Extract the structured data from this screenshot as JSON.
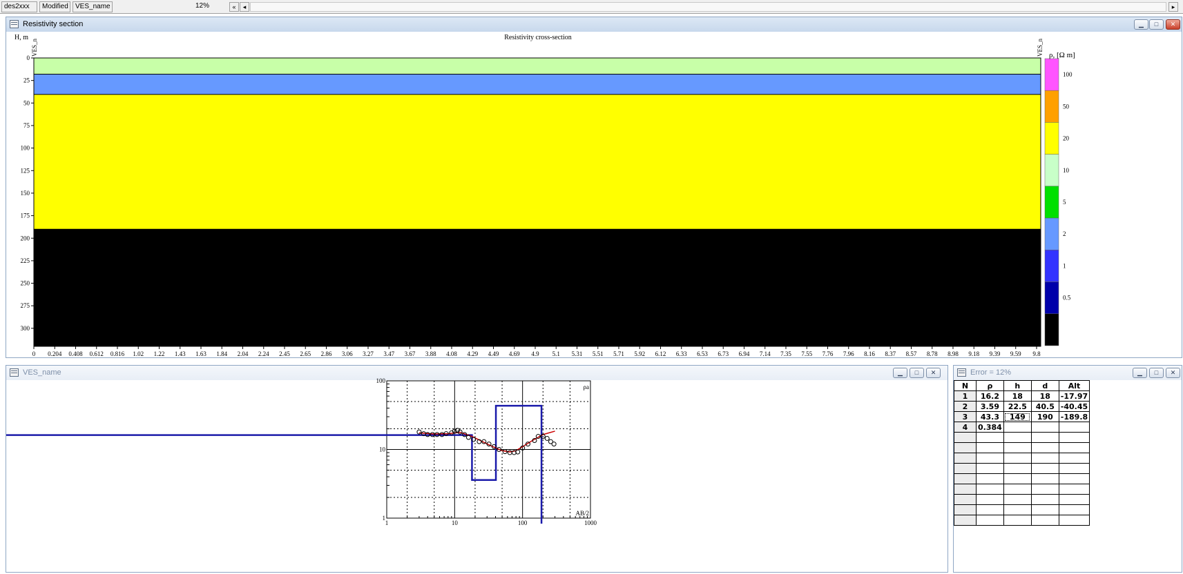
{
  "statusbar": {
    "file": "des2xxx",
    "state": "Modified",
    "ves": "VES_name",
    "error": "12%",
    "nav_first": "«",
    "nav_prev": "◂",
    "nav_next": "▸"
  },
  "section_window": {
    "title": "Resistivity section",
    "chart_title": "Resistivity cross-section",
    "y_axis_label": "H, m",
    "left_ves_label": "VES_n",
    "right_ves_label": "VES_n",
    "legend_title": "ρ, [Ω m]"
  },
  "ves_window": {
    "title": "VES_name"
  },
  "table_window": {
    "title": "Error = 12%",
    "headers": [
      "N",
      "ρ",
      "h",
      "d",
      "Alt"
    ],
    "rows": [
      [
        "1",
        "16.2",
        "18",
        "18",
        "-17.97"
      ],
      [
        "2",
        "3.59",
        "22.5",
        "40.5",
        "-40.45"
      ],
      [
        "3",
        "43.3",
        "149",
        "190",
        "-189.8"
      ],
      [
        "4",
        "0.384",
        "",
        "",
        ""
      ]
    ],
    "empty_rows": 9
  },
  "chart_data": [
    {
      "type": "heatmap",
      "title": "Resistivity cross-section",
      "ylabel": "H, m",
      "ylim": [
        0,
        320
      ],
      "y_inverted": true,
      "y_ticks": [
        0,
        25,
        50,
        75,
        100,
        125,
        150,
        175,
        200,
        225,
        250,
        275,
        300
      ],
      "x_ticks": [
        "0",
        "0.204",
        "0.408",
        "0.612",
        "0.816",
        "1.02",
        "1.22",
        "1.43",
        "1.63",
        "1.84",
        "2.04",
        "2.24",
        "2.45",
        "2.65",
        "2.86",
        "3.06",
        "3.27",
        "3.47",
        "3.67",
        "3.88",
        "4.08",
        "4.29",
        "4.49",
        "4.69",
        "4.9",
        "5.1",
        "5.31",
        "5.51",
        "5.71",
        "5.92",
        "6.12",
        "6.33",
        "6.53",
        "6.73",
        "6.94",
        "7.14",
        "7.35",
        "7.55",
        "7.76",
        "7.96",
        "8.16",
        "8.37",
        "8.57",
        "8.78",
        "8.98",
        "9.18",
        "9.39",
        "9.59",
        "9.8"
      ],
      "layers": [
        {
          "top": 0,
          "bottom": 18,
          "resistivity": 16.2,
          "color": "#c8ffa8"
        },
        {
          "top": 18,
          "bottom": 40.5,
          "resistivity": 3.59,
          "color": "#6699ff"
        },
        {
          "top": 40.5,
          "bottom": 190,
          "resistivity": 43.3,
          "color": "#ffff00"
        },
        {
          "top": 190,
          "bottom": 320,
          "resistivity": 0.384,
          "color": "#000000"
        }
      ],
      "legend": {
        "title": "ρ, [Ω m]",
        "boundaries": [
          "100",
          "50",
          "20",
          "10",
          "5",
          "2",
          "1",
          "0.5"
        ],
        "colors": [
          "#ff55ff",
          "#ffa000",
          "#ffff00",
          "#c8ffc8",
          "#00e000",
          "#6699ff",
          "#3333ff",
          "#0000aa",
          "#000000"
        ]
      }
    },
    {
      "type": "line",
      "x_scale": "log",
      "y_scale": "log",
      "xlim": [
        1,
        1000
      ],
      "ylim": [
        1,
        100
      ],
      "xlabel": "AB/2",
      "ylabel": "ρa",
      "x_ticks": [
        "1",
        "10",
        "100",
        "1000"
      ],
      "y_ticks": [
        "1",
        "10",
        "100"
      ],
      "series": [
        {
          "kind": "observed-points",
          "x": [
            3,
            3.5,
            4,
            4.7,
            5.5,
            6.5,
            7.5,
            9,
            10,
            11,
            12,
            14,
            16,
            19,
            23,
            27,
            32,
            38,
            45,
            55,
            65,
            75,
            85,
            100,
            120,
            150,
            170,
            200,
            230,
            260,
            290
          ],
          "y": [
            18,
            17,
            16.5,
            16.5,
            16.5,
            16.5,
            17,
            17.5,
            18.5,
            19,
            18,
            16.5,
            15,
            14,
            13,
            13,
            12,
            11,
            10,
            9.3,
            9,
            9,
            9.2,
            10.5,
            12,
            13.5,
            15.5,
            15.5,
            14.5,
            13,
            12
          ]
        },
        {
          "kind": "calculated-curve",
          "color": "#cc0000",
          "x": [
            3,
            5,
            8,
            12,
            18,
            25,
            35,
            50,
            65,
            80,
            100,
            140,
            200,
            300
          ],
          "y": [
            17.5,
            16.8,
            17,
            17.8,
            15.5,
            13.2,
            11.2,
            9.6,
            9.2,
            9.6,
            11,
            13.5,
            16.5,
            18.5
          ]
        },
        {
          "kind": "layer-model",
          "color": "#1a1aaa",
          "x": [
            0.001,
            18,
            18,
            40.5,
            40.5,
            190,
            190,
            190
          ],
          "y": [
            16.2,
            16.2,
            3.59,
            3.59,
            43.3,
            43.3,
            1,
            0.384
          ]
        }
      ]
    }
  ]
}
